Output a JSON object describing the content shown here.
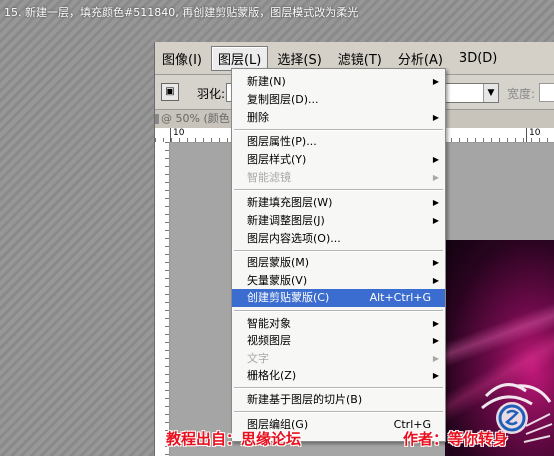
{
  "caption": "15. 新建一层，填充颜色#511840, 再创建剪贴蒙版，图层模式改为柔光",
  "menubar": {
    "items": [
      {
        "label": "图像(I)"
      },
      {
        "label": "图层(L)"
      },
      {
        "label": "选择(S)"
      },
      {
        "label": "滤镜(T)"
      },
      {
        "label": "分析(A)"
      },
      {
        "label": "3D(D)"
      }
    ]
  },
  "toolbar": {
    "feather_label": "羽化:",
    "width_label": "宽度:"
  },
  "document": {
    "title": "@ 50% (颜色",
    "ruler_tick_a": "10",
    "ruler_tick_b": "10"
  },
  "layer_menu": {
    "items": [
      {
        "label": "新建(N)",
        "submenu": true
      },
      {
        "label": "复制图层(D)..."
      },
      {
        "label": "删除",
        "submenu": true
      },
      {
        "label": "图层属性(P)..."
      },
      {
        "label": "图层样式(Y)",
        "submenu": true
      },
      {
        "label": "智能滤镜",
        "submenu": true,
        "disabled": true
      },
      {
        "label": "新建填充图层(W)",
        "submenu": true
      },
      {
        "label": "新建调整图层(J)",
        "submenu": true
      },
      {
        "label": "图层内容选项(O)..."
      },
      {
        "label": "图层蒙版(M)",
        "submenu": true
      },
      {
        "label": "矢量蒙版(V)",
        "submenu": true
      },
      {
        "label": "创建剪贴蒙版(C)",
        "shortcut": "Alt+Ctrl+G",
        "highlighted": true
      },
      {
        "label": "智能对象",
        "submenu": true
      },
      {
        "label": "视频图层",
        "submenu": true
      },
      {
        "label": "文字",
        "submenu": true,
        "disabled": true
      },
      {
        "label": "栅格化(Z)",
        "submenu": true
      },
      {
        "label": "新建基于图层的切片(B)"
      },
      {
        "label": "图层编组(G)",
        "shortcut": "Ctrl+G"
      }
    ]
  },
  "watermark": {
    "left": "教程出自：思缘论坛",
    "right": "作者：等你转身"
  },
  "colors": {
    "menu_highlight": "#3b6ccf",
    "watermark_red": "#e8101e"
  }
}
